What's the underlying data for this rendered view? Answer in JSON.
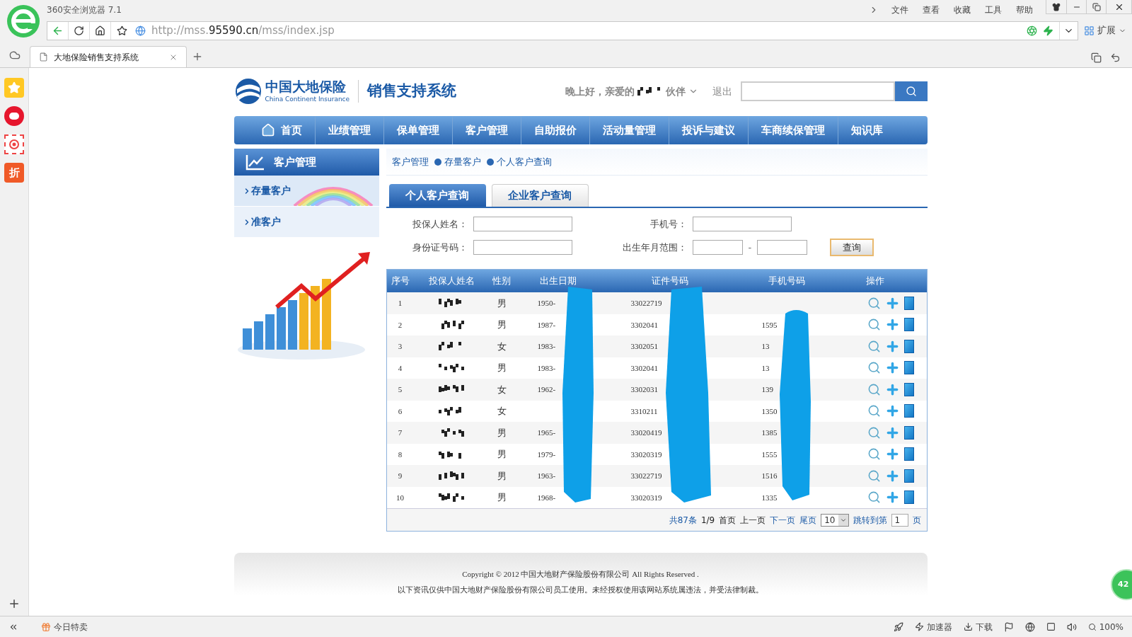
{
  "browser": {
    "title": "360安全浏览器 7.1",
    "menu": [
      "文件",
      "查看",
      "收藏",
      "工具",
      "帮助"
    ],
    "url_scheme": "http://mss.",
    "url_domain": "95590.cn",
    "url_path": "/mss/index.jsp",
    "extension_label": "扩展",
    "tabs": [
      {
        "label": "大地保险销售支持系统",
        "selected": true
      }
    ],
    "sidebar_app_text": "折",
    "floating_badge": "42"
  },
  "site": {
    "logo_cn": "中国大地保险",
    "logo_en": "China Continent Insurance",
    "system_name": "销售支持系统",
    "greeting": "晚上好，亲爱的",
    "greeting_role": "伙伴",
    "logout": "退出"
  },
  "nav": [
    {
      "label": "首页",
      "kind": "home"
    },
    {
      "label": "业绩管理",
      "kind": "link"
    },
    {
      "label": "保单管理",
      "kind": "link"
    },
    {
      "label": "客户管理",
      "kind": "link"
    },
    {
      "label": "自助报价",
      "kind": "link"
    },
    {
      "label": "活动量管理",
      "kind": "link"
    },
    {
      "label": "投诉与建议",
      "kind": "link"
    },
    {
      "label": "车商续保管理",
      "kind": "link"
    },
    {
      "label": "知识库",
      "kind": "link"
    }
  ],
  "side_menu": {
    "title": "客户管理",
    "items": [
      {
        "label": "存量客户",
        "selected": true
      },
      {
        "label": "准客户",
        "selected": false
      }
    ]
  },
  "breadcrumb": [
    "客户管理",
    "存量客户",
    "个人客户查询"
  ],
  "query_tabs": [
    {
      "label": "个人客户查询",
      "selected": true
    },
    {
      "label": "企业客户查询",
      "selected": false
    }
  ],
  "form": {
    "fields": [
      {
        "label": "投保人姓名：",
        "kind": "text"
      },
      {
        "label": "手机号：",
        "kind": "text"
      },
      {
        "label": "身份证号码：",
        "kind": "text"
      },
      {
        "label": "出生年月范围：",
        "kind": "range",
        "separator": "-"
      }
    ],
    "button": "查询"
  },
  "table": {
    "columns": [
      "序号",
      "投保人姓名",
      "性别",
      "出生日期",
      "证件号码",
      "手机号码",
      "操作"
    ],
    "rows": [
      {
        "index": "1",
        "gender": "男",
        "birth_date": "1950-",
        "id_number": "33022719",
        "mobile": ""
      },
      {
        "index": "2",
        "gender": "男",
        "birth_date": "1987-",
        "id_number": "3302041",
        "mobile": "1595"
      },
      {
        "index": "3",
        "gender": "女",
        "birth_date": "1983-",
        "id_number": "3302051",
        "mobile": "13"
      },
      {
        "index": "4",
        "gender": "男",
        "birth_date": "1983-",
        "id_number": "3302041",
        "mobile": "13"
      },
      {
        "index": "5",
        "gender": "女",
        "birth_date": "1962-",
        "id_number": "3302031",
        "mobile": "139"
      },
      {
        "index": "6",
        "gender": "女",
        "birth_date": "",
        "id_number": "3310211",
        "mobile": "1350"
      },
      {
        "index": "7",
        "gender": "男",
        "birth_date": "1965-",
        "id_number": "33020419",
        "mobile": "1385"
      },
      {
        "index": "8",
        "gender": "男",
        "birth_date": "1979-",
        "id_number": "33020319",
        "mobile": "1555"
      },
      {
        "index": "9",
        "gender": "男",
        "birth_date": "1963-",
        "id_number": "33022719",
        "mobile": "1516"
      },
      {
        "index": "10",
        "gender": "男",
        "birth_date": "1968-",
        "id_number": "33020319",
        "mobile": "1335"
      }
    ]
  },
  "pager": {
    "total": "共87条",
    "page": "1/9",
    "links": [
      {
        "label": "首页",
        "disabled": true
      },
      {
        "label": "上一页",
        "disabled": true
      },
      {
        "label": "下一页",
        "disabled": false
      },
      {
        "label": "尾页",
        "disabled": false
      }
    ],
    "page_size": "10",
    "jump_label": "跳转到第",
    "jump_value": "1",
    "jump_suffix": "页"
  },
  "footer": [
    "Copyright © 2012 中国大地财产保险股份有限公司 All Rights Reserved .",
    "以下资讯仅供中国大地财产保险股份有限公司员工使用。未经授权使用该网站系统属违法，并受法律制裁。"
  ],
  "status_bar": {
    "left": "今日特卖",
    "items": [
      "加速器",
      "下载"
    ],
    "zoom": "100%"
  }
}
